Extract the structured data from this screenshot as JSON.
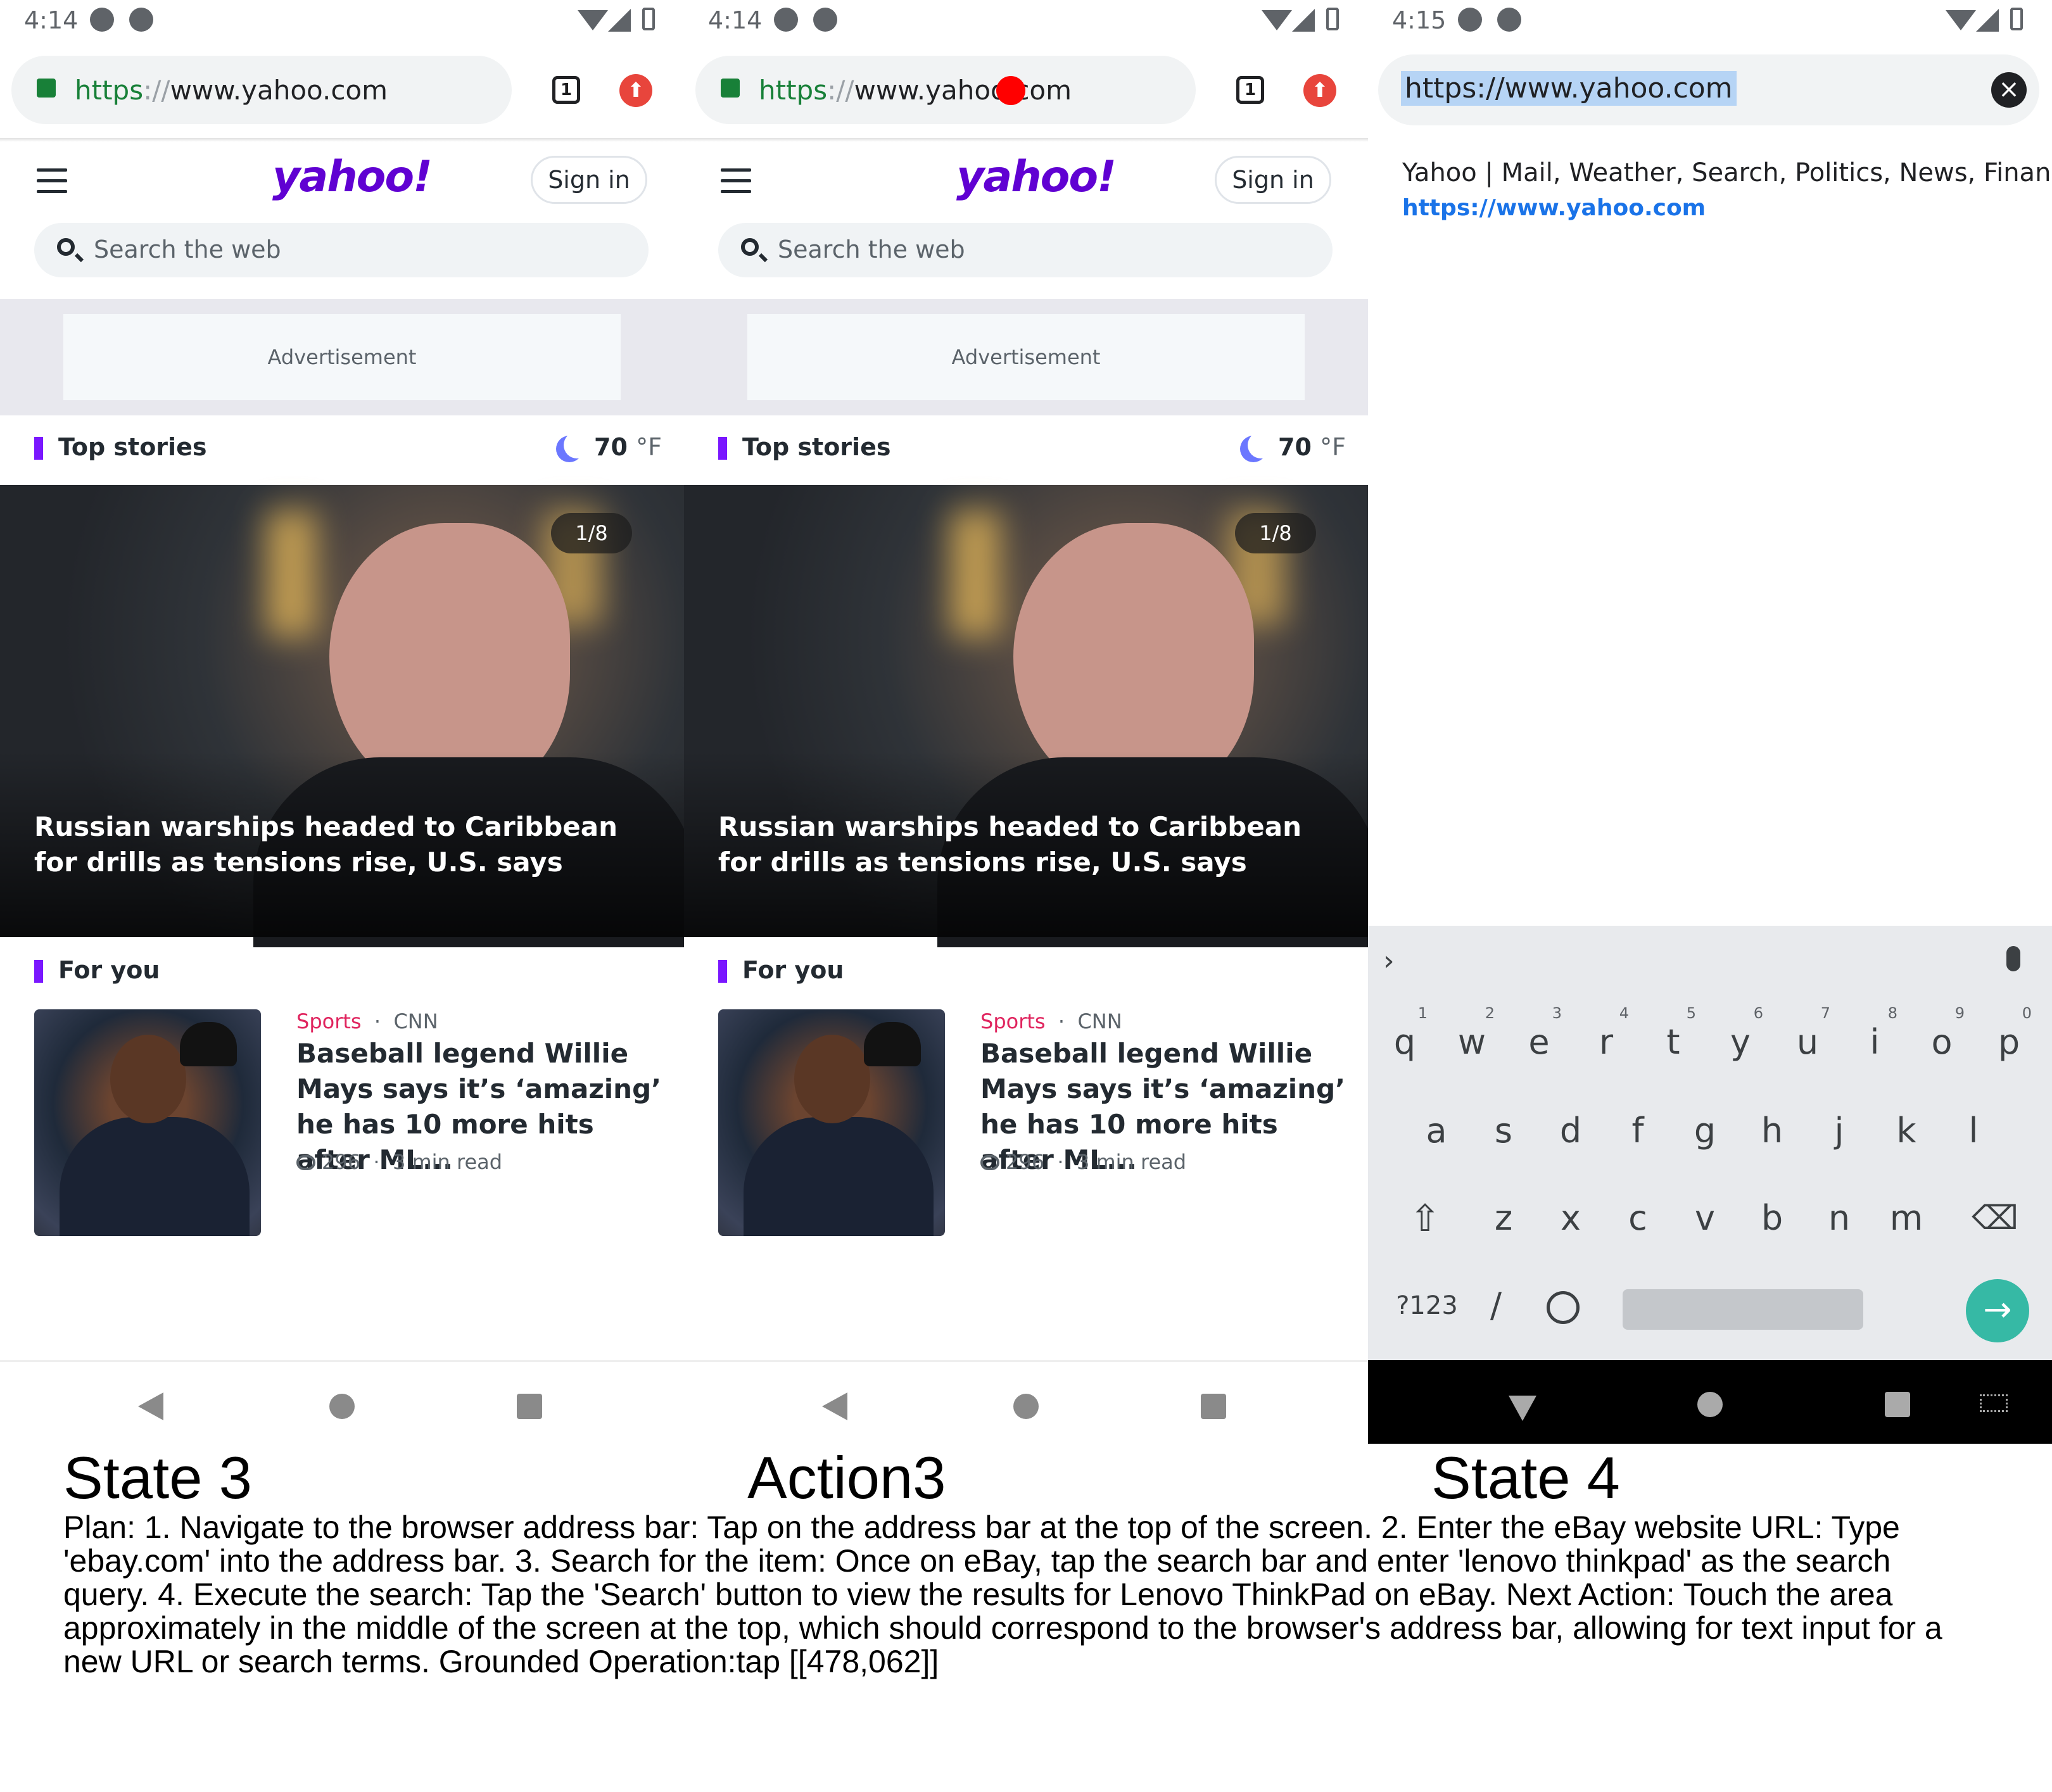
{
  "panels": [
    {
      "status": {
        "time": "4:14"
      },
      "browser": {
        "url_scheme": "https",
        "url_sep": "://",
        "url_rest": "www.yahoo.com",
        "tab_count": "1"
      },
      "yahoo": {
        "logo": "yahoo!",
        "signin": "Sign in",
        "search_placeholder": "Search the web",
        "ad_label": "Advertisement",
        "top_stories_title": "Top stories",
        "weather_temp": "70",
        "weather_unit": "°F",
        "hero_counter": "1/8",
        "hero_headline": "Russian warships headed to Caribbean for drills as tensions rise, U.S. says",
        "for_you_title": "For you",
        "story": {
          "category": "Sports",
          "source": "CNN",
          "title": "Baseball legend Willie Mays says it’s ‘amazing’ he has 10 more hits after ML...",
          "comments": "296",
          "read_time": "3 min read"
        }
      }
    },
    {
      "status": {
        "time": "4:14"
      },
      "browser": {
        "url_scheme": "https",
        "url_sep": "://",
        "url_rest": "www.yahoo.com",
        "tab_count": "1"
      },
      "yahoo": {
        "logo": "yahoo!",
        "signin": "Sign in",
        "search_placeholder": "Search the web",
        "ad_label": "Advertisement",
        "top_stories_title": "Top stories",
        "weather_temp": "70",
        "weather_unit": "°F",
        "hero_counter": "1/8",
        "hero_headline": "Russian warships headed to Caribbean for drills as tensions rise, U.S. says",
        "for_you_title": "For you",
        "story": {
          "category": "Sports",
          "source": "CNN",
          "title": "Baseball legend Willie Mays says it’s ‘amazing’ he has 10 more hits after ML...",
          "comments": "296",
          "read_time": "3 min read"
        }
      }
    },
    {
      "status": {
        "time": "4:15"
      },
      "omnibox": {
        "selected_url": "https://www.yahoo.com",
        "clear_icon": "×"
      },
      "suggestion": {
        "title": "Yahoo | Mail, Weather, Search, Politics, News, Finance",
        "url": "https://www.yahoo.com"
      },
      "keyboard": {
        "row1": [
          {
            "key": "q",
            "hint": "1"
          },
          {
            "key": "w",
            "hint": "2"
          },
          {
            "key": "e",
            "hint": "3"
          },
          {
            "key": "r",
            "hint": "4"
          },
          {
            "key": "t",
            "hint": "5"
          },
          {
            "key": "y",
            "hint": "6"
          },
          {
            "key": "u",
            "hint": "7"
          },
          {
            "key": "i",
            "hint": "8"
          },
          {
            "key": "o",
            "hint": "9"
          },
          {
            "key": "p",
            "hint": "0"
          }
        ],
        "row2": [
          "a",
          "s",
          "d",
          "f",
          "g",
          "h",
          "j",
          "k",
          "l"
        ],
        "row3": [
          "z",
          "x",
          "c",
          "v",
          "b",
          "n",
          "m"
        ],
        "shift_glyph": "⇧",
        "backspace_glyph": "⌫",
        "symbols": "?123",
        "slash": "/",
        "period": ".",
        "go_glyph": "→",
        "chevron": "›"
      }
    }
  ],
  "captions": {
    "state3": "State 3",
    "action3": "Action3",
    "state4": "State 4"
  },
  "plan_text": "Plan: 1. Navigate to the browser address bar: Tap on the address bar at the top of the screen. 2. Enter the eBay website URL: Type 'ebay.com' into the address bar. 3. Search for the item: Once on eBay, tap the search bar and enter 'lenovo thinkpad' as the search query. 4. Execute the search: Tap the 'Search' button to view the results for Lenovo ThinkPad on eBay. Next Action: Touch the area approximately in the middle of the screen at the top, which should correspond to the browser's address bar, allowing for text input for a new URL or search terms. Grounded Operation:tap [[478,062]]",
  "colors": {
    "yahoo_purple": "#6001d2",
    "accent_bar": "#7a17ff",
    "sports_red": "#e0245e",
    "link_blue": "#1a73e8",
    "go_teal": "#36b9a5",
    "tap_marker": "#ff0000"
  }
}
